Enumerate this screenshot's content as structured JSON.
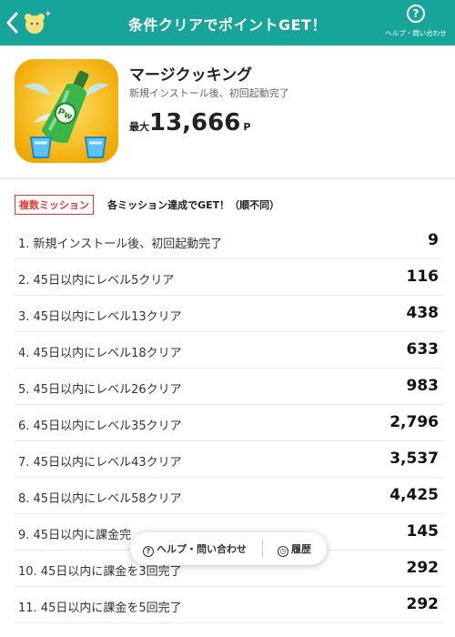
{
  "header": {
    "title": "条件クリアでポイントGET！",
    "help_label": "ヘルプ・問い合わせ",
    "help_icon": "question-circle-icon",
    "back_icon": "chevron-left-icon",
    "mascot_icon": "mascot-icon"
  },
  "app": {
    "name": "マージクッキング",
    "condition": "新規インストール後、初回起動完了",
    "points_prefix": "最大",
    "points": "13,666",
    "points_unit": "P"
  },
  "missions": {
    "badge": "複数ミッション",
    "note": "各ミッション達成でGET！（順不同）",
    "rows": [
      {
        "label": "1. 新規インストール後、初回起動完了",
        "points": "9"
      },
      {
        "label": "2. 45日以内にレベル5クリア",
        "points": "116"
      },
      {
        "label": "3. 45日以内にレベル13クリア",
        "points": "438"
      },
      {
        "label": "4. 45日以内にレベル18クリア",
        "points": "633"
      },
      {
        "label": "5. 45日以内にレベル26クリア",
        "points": "983"
      },
      {
        "label": "6. 45日以内にレベル35クリア",
        "points": "2,796"
      },
      {
        "label": "7. 45日以内にレベル43クリア",
        "points": "3,537"
      },
      {
        "label": "8. 45日以内にレベル58クリア",
        "points": "4,425"
      },
      {
        "label": "9. 45日以内に課金完",
        "points": "145"
      },
      {
        "label": "10. 45日以内に課金を3回完了",
        "points": "292"
      },
      {
        "label": "11. 45日以内に課金を5回完了",
        "points": "292"
      }
    ]
  },
  "floating_bar": {
    "help_label": "ヘルプ・問い合わせ",
    "history_label": "履歴",
    "help_icon": "question-circle-icon",
    "history_icon": "history-clock-icon"
  },
  "colors": {
    "header_bg": "#16a598",
    "badge_red": "#e53935",
    "app_icon_bg": "#f6c21a"
  }
}
